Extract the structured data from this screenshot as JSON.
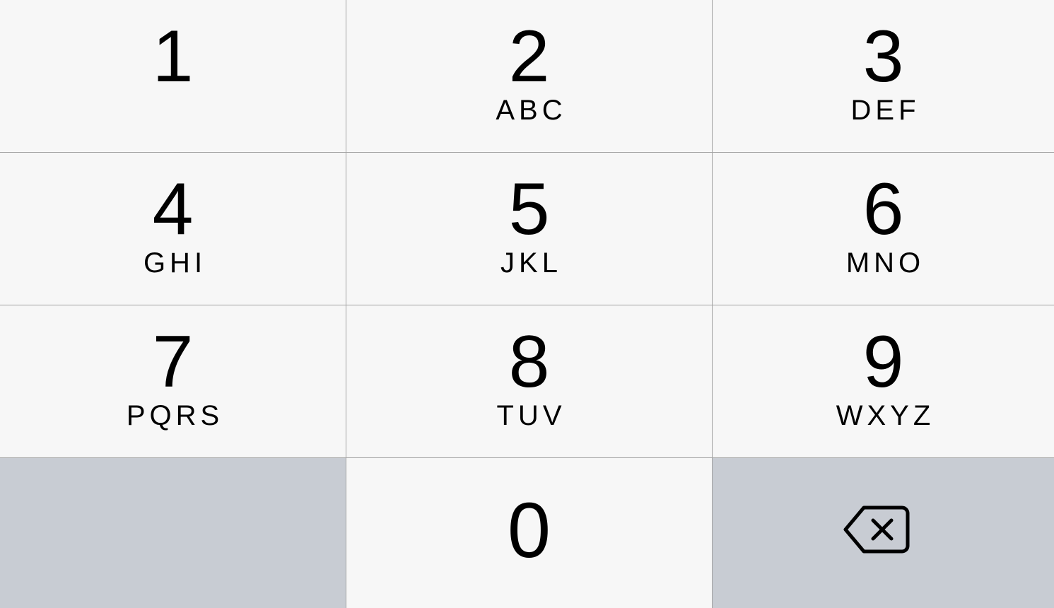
{
  "keypad": {
    "keys": [
      {
        "digit": "1",
        "letters": ""
      },
      {
        "digit": "2",
        "letters": "ABC"
      },
      {
        "digit": "3",
        "letters": "DEF"
      },
      {
        "digit": "4",
        "letters": "GHI"
      },
      {
        "digit": "5",
        "letters": "JKL"
      },
      {
        "digit": "6",
        "letters": "MNO"
      },
      {
        "digit": "7",
        "letters": "PQRS"
      },
      {
        "digit": "8",
        "letters": "TUV"
      },
      {
        "digit": "9",
        "letters": "WXYZ"
      },
      {
        "digit": "0",
        "letters": ""
      }
    ],
    "delete_icon": "backspace-icon"
  },
  "colors": {
    "key_background": "#f7f7f7",
    "function_key_background": "#c8ccd3",
    "divider": "#a2a2a2",
    "text": "#000000"
  }
}
